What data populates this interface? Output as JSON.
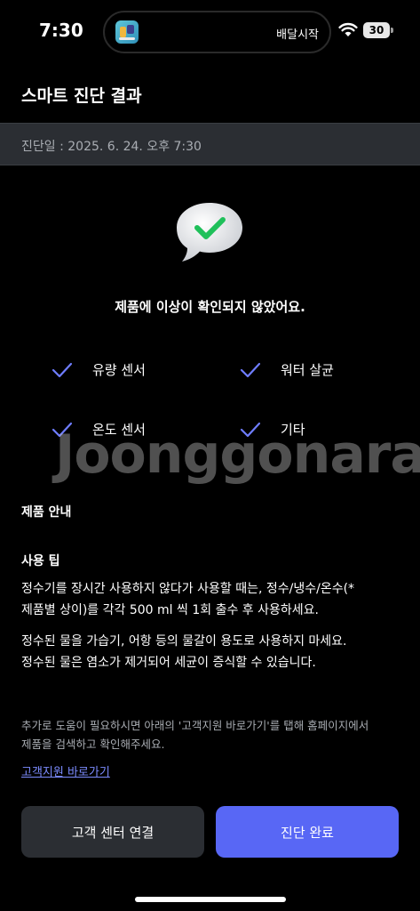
{
  "status_bar": {
    "time": "7:30",
    "live_activity_text": "배달시작",
    "battery": "30"
  },
  "header": {
    "title": "스마트 진단 결과"
  },
  "diagnosis": {
    "date_text": "진단일 : 2025. 6. 24. 오후 7:30"
  },
  "result": {
    "message": "제품에 이상이 확인되지 않았어요."
  },
  "checks": [
    {
      "label": "유량 센서"
    },
    {
      "label": "워터 살균"
    },
    {
      "label": "온도 센서"
    },
    {
      "label": "기타"
    }
  ],
  "watermark": "Joonggonara",
  "product_info": {
    "title": "제품 안내",
    "tips_title": "사용 팁",
    "tip1_line1": "정수기를 장시간 사용하지 않다가 사용할 때는, 정수/냉수/온수(*",
    "tip1_line2": "제품별 상이)를 각각 500 ml 씩 1회 출수 후 사용하세요.",
    "tip2_line1": "정수된 물을 가습기, 어항 등의 물갈이 용도로 사용하지 마세요.",
    "tip2_line2": "정수된 물은 염소가 제거되어 세균이 증식할 수 있습니다."
  },
  "help": {
    "text_line1": "추가로 도움이 필요하시면 아래의 '고객지원 바로가기'를 탭해 홈페이지에서",
    "text_line2": "제품을 검색하고 확인해주세요.",
    "link": "고객지원 바로가기"
  },
  "buttons": {
    "secondary": "고객 센터 연결",
    "primary": "진단 완료"
  },
  "colors": {
    "accent": "#5867f5",
    "check": "#6f7dff",
    "success_check": "#1fc05a",
    "card": "#2b2e33",
    "muted_text": "#a9adb3"
  }
}
